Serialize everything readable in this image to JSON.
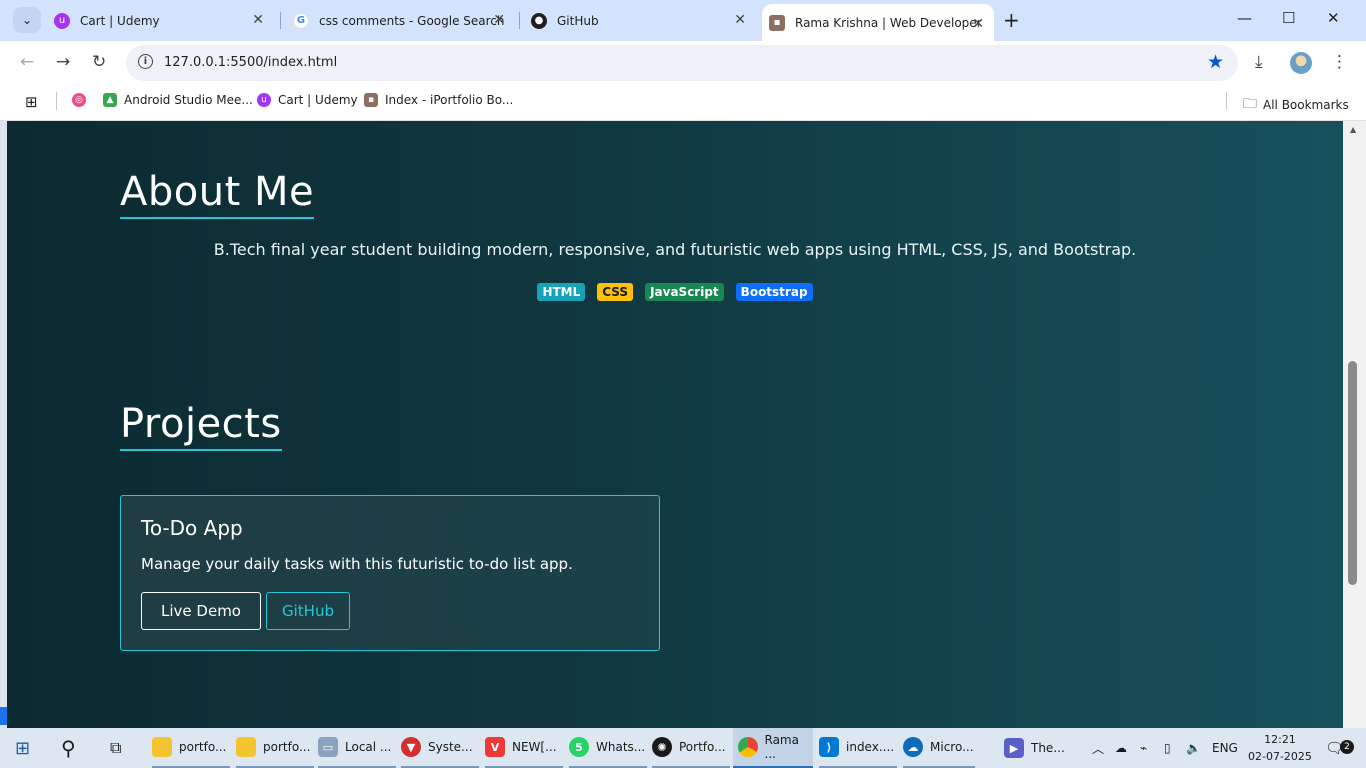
{
  "browser": {
    "tabs": [
      {
        "label": "Cart | Udemy",
        "favicon": "udemy-icon",
        "active": false
      },
      {
        "label": "css comments - Google Search",
        "favicon": "google-icon",
        "active": false
      },
      {
        "label": "GitHub",
        "favicon": "github-icon",
        "active": false
      },
      {
        "label": "Rama Krishna | Web Developer",
        "favicon": "page-icon",
        "active": true
      }
    ],
    "url": "127.0.0.1:5500/index.html",
    "bookmarks": [
      {
        "label": "Android Studio Mee...",
        "icon": "android-icon"
      },
      {
        "label": "Cart | Udemy",
        "icon": "udemy-icon"
      },
      {
        "label": "Index - iPortfolio Bo...",
        "icon": "page-icon"
      }
    ],
    "all_bookmarks": "All Bookmarks",
    "colors": {
      "tabstrip": "#d3e3fd",
      "accent": "#0b57d0"
    }
  },
  "page": {
    "about": {
      "title": "About Me",
      "text": "B.Tech final year student building modern, responsive, and futuristic web apps using HTML, CSS, JS, and Bootstrap.",
      "badges": [
        "HTML",
        "CSS",
        "JavaScript",
        "Bootstrap"
      ]
    },
    "projects": {
      "title": "Projects",
      "card": {
        "title": "To-Do App",
        "text": "Manage your daily tasks with this futuristic to-do list app.",
        "demo_label": "Live Demo",
        "github_label": "GitHub"
      }
    },
    "colors": {
      "accent": "#26c6da",
      "background": "#103840"
    }
  },
  "taskbar": {
    "items": [
      {
        "label": "portfo...",
        "icon": "folder-icon"
      },
      {
        "label": "portfo...",
        "icon": "folder-icon"
      },
      {
        "label": "Local ...",
        "icon": "drive-icon"
      },
      {
        "label": "Syste...",
        "icon": "app-icon"
      },
      {
        "label": "NEW[...",
        "icon": "vivaldi-icon"
      },
      {
        "label": "Whats...",
        "icon": "whatsapp-icon",
        "badge": "5"
      },
      {
        "label": "Portfo...",
        "icon": "chatgpt-icon"
      },
      {
        "label": "Rama ...",
        "icon": "chrome-icon"
      },
      {
        "label": "index....",
        "icon": "vscode-icon"
      },
      {
        "label": "Micro...",
        "icon": "onedrive-icon"
      },
      {
        "label": "The...",
        "icon": "video-icon"
      }
    ],
    "language": "ENG",
    "time": "12:21",
    "date": "02-07-2025",
    "notifications": "2"
  }
}
